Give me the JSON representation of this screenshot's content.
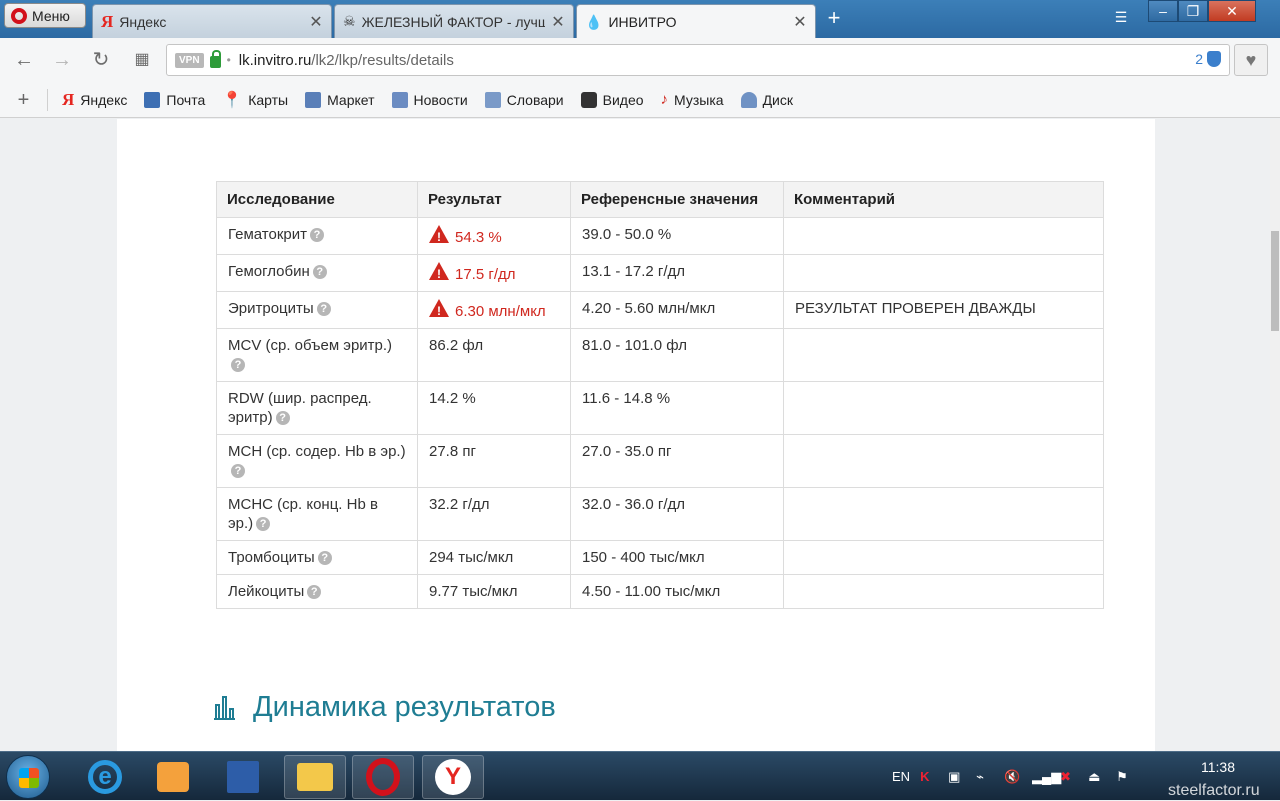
{
  "browser": {
    "menu_label": "Меню",
    "tabs": [
      {
        "title": "Яндекс"
      },
      {
        "title": "ЖЕЛЕЗНЫЙ ФАКТОР - лучший"
      },
      {
        "title": "ИНВИТРО"
      }
    ],
    "url_host": "lk.invitro.ru",
    "url_path": "/lk2/lkp/results/details",
    "vpn_label": "VPN",
    "shield_count": "2",
    "bookmarks": [
      "Яндекс",
      "Почта",
      "Карты",
      "Маркет",
      "Новости",
      "Словари",
      "Видео",
      "Музыка",
      "Диск"
    ]
  },
  "results_table": {
    "headers": [
      "Исследование",
      "Результат",
      "Референсные значения",
      "Комментарий"
    ],
    "rows": [
      {
        "name": "Гематокрит",
        "result": "54.3 %",
        "ref": "39.0 - 50.0 %",
        "comment": "",
        "flagged": true
      },
      {
        "name": "Гемоглобин",
        "result": "17.5 г/дл",
        "ref": "13.1 - 17.2 г/дл",
        "comment": "",
        "flagged": true
      },
      {
        "name": "Эритроциты",
        "result": "6.30 млн/мкл",
        "ref": "4.20 - 5.60 млн/мкл",
        "comment": "РЕЗУЛЬТАТ ПРОВЕРЕН ДВАЖДЫ",
        "flagged": true
      },
      {
        "name": "MCV (ср. объем эритр.)",
        "result": "86.2 фл",
        "ref": "81.0 - 101.0 фл",
        "comment": "",
        "flagged": false
      },
      {
        "name": "RDW (шир. распред. эритр)",
        "result": "14.2 %",
        "ref": "11.6 - 14.8 %",
        "comment": "",
        "flagged": false
      },
      {
        "name": "MCH (ср. содер. Hb в эр.)",
        "result": "27.8 пг",
        "ref": "27.0 - 35.0 пг",
        "comment": "",
        "flagged": false
      },
      {
        "name": "MCHC (ср. конц. Hb в эр.)",
        "result": "32.2 г/дл",
        "ref": "32.0 - 36.0 г/дл",
        "comment": "",
        "flagged": false
      },
      {
        "name": "Тромбоциты",
        "result": "294 тыс/мкл",
        "ref": "150 - 400 тыс/мкл",
        "comment": "",
        "flagged": false
      },
      {
        "name": "Лейкоциты",
        "result": "9.77 тыс/мкл",
        "ref": "4.50 - 11.00 тыс/мкл",
        "comment": "",
        "flagged": false
      }
    ]
  },
  "dynamics": {
    "title": "Динамика результатов"
  },
  "taskbar": {
    "lang": "EN",
    "time": "11:38",
    "watermark": "steelfactor.ru"
  },
  "colors": {
    "accent": "#1f7d93",
    "warning": "#d0281f"
  }
}
